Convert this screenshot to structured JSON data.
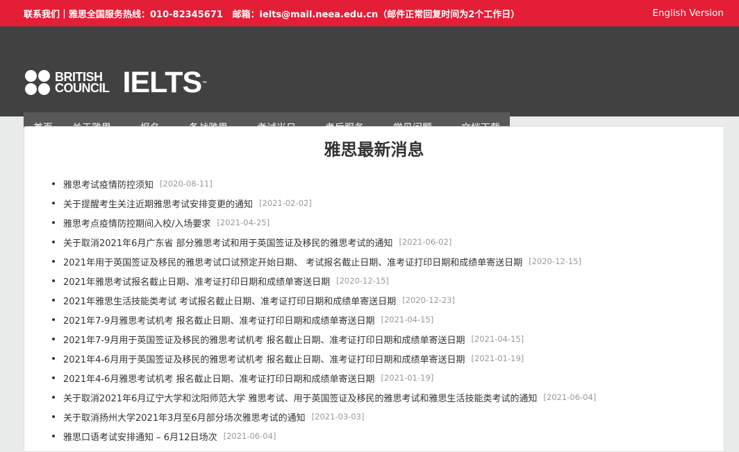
{
  "topbar": {
    "contact_label": "联系我们",
    "hotline": "｜雅思全国服务热线：010-82345671",
    "email": "邮箱：ielts@mail.neea.edu.cn（邮件正常回复时间为2个工作日）",
    "lang_link": "English Version"
  },
  "logo": {
    "bc_line1": "BRITISH",
    "bc_line2": "COUNCIL",
    "ielts": "IELTS",
    "tm": "™"
  },
  "nav": {
    "items": [
      {
        "label": "首页",
        "has_dropdown": false
      },
      {
        "label": "关于雅思",
        "has_dropdown": true
      },
      {
        "label": "报名",
        "has_dropdown": true
      },
      {
        "label": "备战雅思",
        "has_dropdown": true
      },
      {
        "label": "考试当日",
        "has_dropdown": true
      },
      {
        "label": "考后服务",
        "has_dropdown": true
      },
      {
        "label": "常见问题",
        "has_dropdown": true
      },
      {
        "label": "文档下载",
        "has_dropdown": false
      }
    ]
  },
  "main": {
    "title": "雅思最新消息",
    "news": [
      {
        "title": "雅思考试疫情防控须知",
        "date": "[2020-08-11]"
      },
      {
        "title": "关于提醒考生关注近期雅思考试安排变更的通知",
        "date": "[2021-02-02]"
      },
      {
        "title": "雅思考点疫情防控期间入校/入场要求",
        "date": "[2021-04-25]"
      },
      {
        "title": "关于取消2021年6月广东省 部分雅思考试和用于英国签证及移民的雅思考试的通知",
        "date": "[2021-06-02]"
      },
      {
        "title": "2021年用于英国签证及移民的雅思考试口试预定开始日期、 考试报名截止日期、准考证打印日期和成绩单寄送日期",
        "date": "[2020-12-15]"
      },
      {
        "title": "2021年雅思考试报名截止日期、准考证打印日期和成绩单寄送日期",
        "date": "[2020-12-15]"
      },
      {
        "title": "2021年雅思生活技能类考试 考试报名截止日期、准考证打印日期和成绩单寄送日期",
        "date": "[2020-12-23]"
      },
      {
        "title": "2021年7-9月雅思考试机考 报名截止日期、准考证打印日期和成绩单寄送日期",
        "date": "[2021-04-15]"
      },
      {
        "title": "2021年7-9月用于英国签证及移民的雅思考试机考 报名截止日期、准考证打印日期和成绩单寄送日期",
        "date": "[2021-04-15]"
      },
      {
        "title": "2021年4-6月用于英国签证及移民的雅思考试机考 报名截止日期、准考证打印日期和成绩单寄送日期",
        "date": "[2021-01-19]"
      },
      {
        "title": "2021年4-6月雅思考试机考 报名截止日期、准考证打印日期和成绩单寄送日期",
        "date": "[2021-01-19]"
      },
      {
        "title": "关于取消2021年6月辽宁大学和沈阳师范大学 雅思考试、用于英国签证及移民的雅思考试和雅思生活技能类考试的通知",
        "date": "[2021-06-04]"
      },
      {
        "title": "关于取消扬州大学2021年3月至6月部分场次雅思考试的通知",
        "date": "[2021-03-03]"
      },
      {
        "title": "雅思口语考试安排通知 – 6月12日场次",
        "date": "[2021-06-04]"
      }
    ]
  },
  "colors": {
    "topbar_bg": "#e41e37",
    "header_bg": "#414141",
    "nav_bg": "#585858",
    "page_bg": "#e9ebeb"
  }
}
